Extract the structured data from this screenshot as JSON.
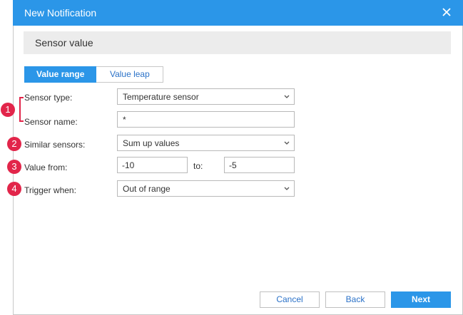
{
  "dialog": {
    "title": "New Notification",
    "close_icon": "close-icon"
  },
  "section": {
    "title": "Sensor value"
  },
  "tabs": [
    {
      "label": "Value range",
      "active": true
    },
    {
      "label": "Value leap",
      "active": false
    }
  ],
  "form": {
    "sensor_type": {
      "label": "Sensor type:",
      "value": "Temperature sensor"
    },
    "sensor_name": {
      "label": "Sensor name:",
      "value": "*"
    },
    "similar_sensors": {
      "label": "Similar sensors:",
      "value": "Sum up values"
    },
    "value_from": {
      "label": "Value from:",
      "from_value": "-10",
      "to_label": "to:",
      "to_value": "-5"
    },
    "trigger_when": {
      "label": "Trigger when:",
      "value": "Out of range"
    }
  },
  "annotations": {
    "badge1": "1",
    "badge2": "2",
    "badge3": "3",
    "badge4": "4",
    "color": "#e2254a"
  },
  "buttons": {
    "cancel": "Cancel",
    "back": "Back",
    "next": "Next"
  },
  "colors": {
    "accent": "#2b96e8",
    "section_bg": "#ececec"
  }
}
